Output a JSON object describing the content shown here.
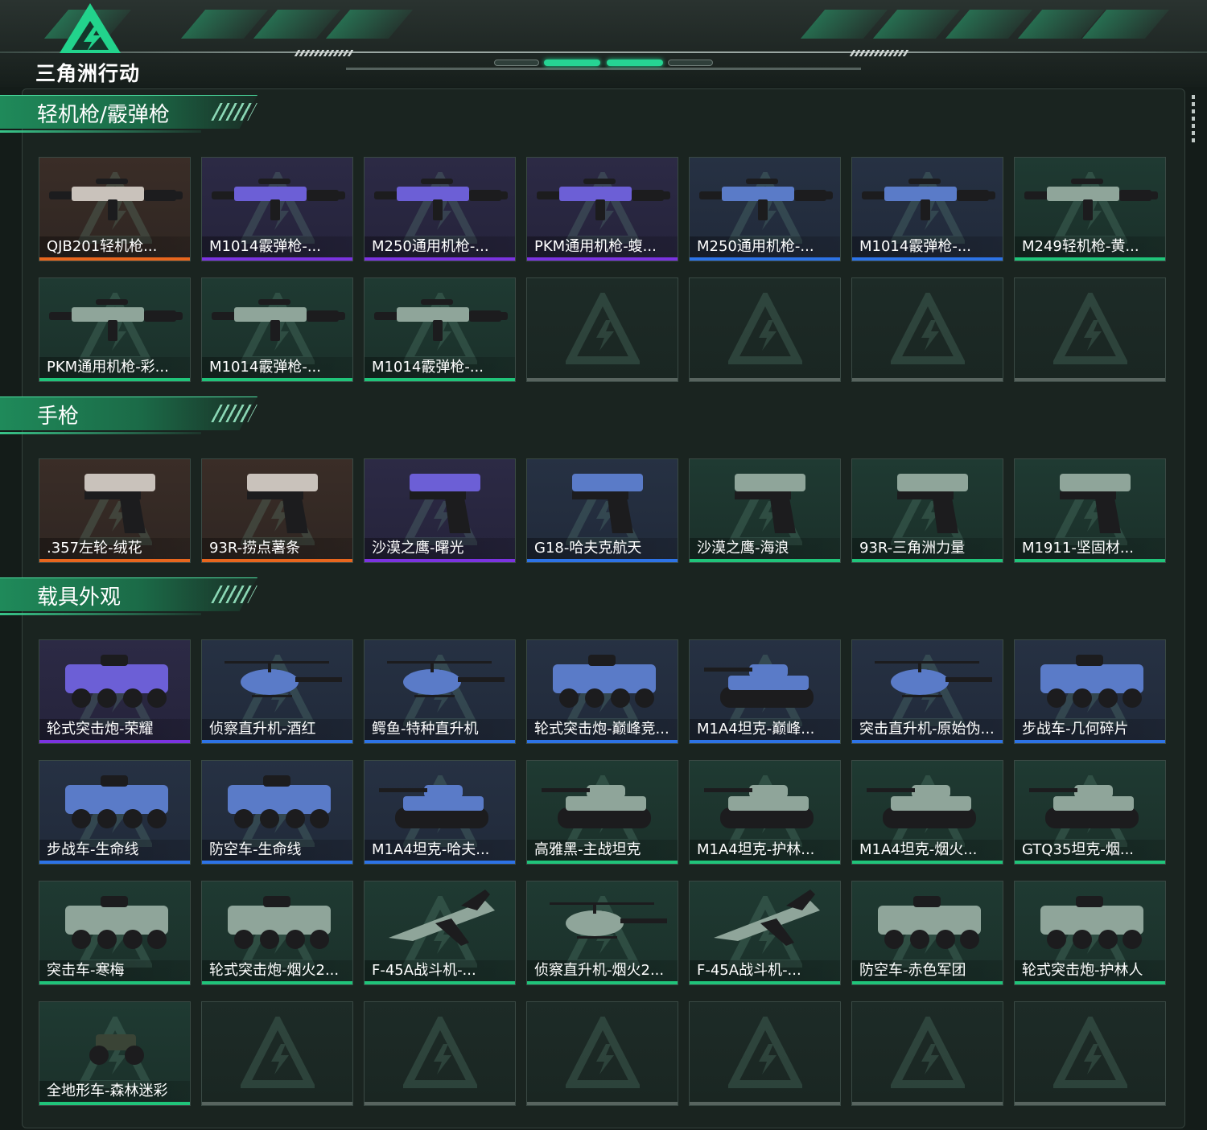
{
  "brand": {
    "logo_text": "三角洲行动"
  },
  "colors": {
    "accent": "#26d493",
    "orange": "#e8661e",
    "purple": "#7b33e0",
    "blue": "#2d73e6",
    "green": "#20c47a"
  },
  "sections": [
    {
      "title": "轻机枪/霰弹枪",
      "items": [
        {
          "label": "QJB201轻机枪...",
          "rarity": "orange",
          "kind": "rifle"
        },
        {
          "label": "M1014霰弹枪-...",
          "rarity": "purple",
          "kind": "rifle"
        },
        {
          "label": "M250通用机枪-...",
          "rarity": "purple",
          "kind": "rifle"
        },
        {
          "label": "PKM通用机枪-蝮...",
          "rarity": "purple",
          "kind": "rifle"
        },
        {
          "label": "M250通用机枪-...",
          "rarity": "blue",
          "kind": "rifle"
        },
        {
          "label": "M1014霰弹枪-...",
          "rarity": "blue",
          "kind": "rifle"
        },
        {
          "label": "M249轻机枪-黄...",
          "rarity": "green",
          "kind": "rifle"
        },
        {
          "label": "PKM通用机枪-彩...",
          "rarity": "green",
          "kind": "rifle"
        },
        {
          "label": "M1014霰弹枪-...",
          "rarity": "green",
          "kind": "rifle"
        },
        {
          "label": "M1014霰弹枪-...",
          "rarity": "green",
          "kind": "rifle"
        },
        {
          "label": "",
          "rarity": "empty",
          "kind": "none"
        },
        {
          "label": "",
          "rarity": "empty",
          "kind": "none"
        },
        {
          "label": "",
          "rarity": "empty",
          "kind": "none"
        },
        {
          "label": "",
          "rarity": "empty",
          "kind": "none"
        }
      ]
    },
    {
      "title": "手枪",
      "items": [
        {
          "label": ".357左轮-绒花",
          "rarity": "orange",
          "kind": "pistol"
        },
        {
          "label": "93R-捞点薯条",
          "rarity": "orange",
          "kind": "pistol"
        },
        {
          "label": "沙漠之鹰-曙光",
          "rarity": "purple",
          "kind": "pistol"
        },
        {
          "label": "G18-哈夫克航天",
          "rarity": "blue",
          "kind": "pistol"
        },
        {
          "label": "沙漠之鹰-海浪",
          "rarity": "green",
          "kind": "pistol"
        },
        {
          "label": "93R-三角洲力量",
          "rarity": "green",
          "kind": "pistol"
        },
        {
          "label": "M1911-坚固材...",
          "rarity": "green",
          "kind": "pistol"
        }
      ]
    },
    {
      "title": "载具外观",
      "items": [
        {
          "label": "轮式突击炮-荣耀",
          "rarity": "purple",
          "kind": "vehicle"
        },
        {
          "label": "侦察直升机-酒红",
          "rarity": "blue",
          "kind": "heli"
        },
        {
          "label": "鳄鱼-特种直升机",
          "rarity": "blue",
          "kind": "heli"
        },
        {
          "label": "轮式突击炮-巅峰竞...",
          "rarity": "blue",
          "kind": "vehicle"
        },
        {
          "label": "M1A4坦克-巅峰...",
          "rarity": "blue",
          "kind": "tank"
        },
        {
          "label": "突击直升机-原始伪...",
          "rarity": "blue",
          "kind": "heli"
        },
        {
          "label": "步战车-几何碎片",
          "rarity": "blue",
          "kind": "vehicle"
        },
        {
          "label": "步战车-生命线",
          "rarity": "blue",
          "kind": "vehicle"
        },
        {
          "label": "防空车-生命线",
          "rarity": "blue",
          "kind": "vehicle"
        },
        {
          "label": "M1A4坦克-哈夫...",
          "rarity": "blue",
          "kind": "tank"
        },
        {
          "label": "高雅黑-主战坦克",
          "rarity": "green",
          "kind": "tank"
        },
        {
          "label": "M1A4坦克-护林...",
          "rarity": "green",
          "kind": "tank"
        },
        {
          "label": "M1A4坦克-烟火...",
          "rarity": "green",
          "kind": "tank"
        },
        {
          "label": "GTQ35坦克-烟...",
          "rarity": "green",
          "kind": "tank"
        },
        {
          "label": "突击车-寒梅",
          "rarity": "green",
          "kind": "vehicle"
        },
        {
          "label": "轮式突击炮-烟火2...",
          "rarity": "green",
          "kind": "vehicle"
        },
        {
          "label": "F-45A战斗机-...",
          "rarity": "green",
          "kind": "jet"
        },
        {
          "label": "侦察直升机-烟火2...",
          "rarity": "green",
          "kind": "heli"
        },
        {
          "label": "F-45A战斗机-...",
          "rarity": "green",
          "kind": "jet"
        },
        {
          "label": "防空车-赤色军团",
          "rarity": "green",
          "kind": "vehicle"
        },
        {
          "label": "轮式突击炮-护林人",
          "rarity": "green",
          "kind": "vehicle"
        },
        {
          "label": "全地形车-森林迷彩",
          "rarity": "green",
          "kind": "atv"
        },
        {
          "label": "",
          "rarity": "empty",
          "kind": "none"
        },
        {
          "label": "",
          "rarity": "empty",
          "kind": "none"
        },
        {
          "label": "",
          "rarity": "empty",
          "kind": "none"
        },
        {
          "label": "",
          "rarity": "empty",
          "kind": "none"
        },
        {
          "label": "",
          "rarity": "empty",
          "kind": "none"
        },
        {
          "label": "",
          "rarity": "empty",
          "kind": "none"
        }
      ]
    }
  ]
}
